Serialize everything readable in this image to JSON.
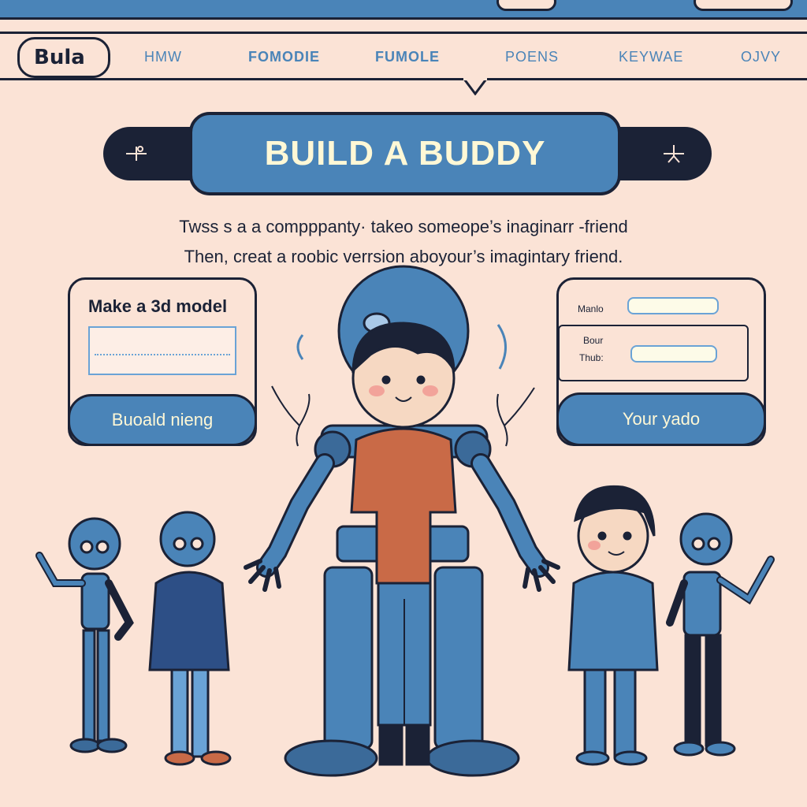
{
  "app": {
    "logo": "Bula"
  },
  "nav": {
    "items": [
      "HMW",
      "FOMODIE",
      "FUMOLE",
      "POENS",
      "KEYWAE",
      "OJVY"
    ]
  },
  "hero": {
    "title": "BUILD A BUDDY",
    "line1": "Twss s a a compppanty· takeo someope’s inaginarr -friend",
    "line2": "Then,  creat a roobic verrsion aboyour’s imagintary friend."
  },
  "left_card": {
    "title": "Make a 3d model",
    "input_value": "",
    "button": "Buoald nieng"
  },
  "right_card": {
    "label1": "Manlo",
    "label2": "Bour",
    "label3": "Thub:",
    "button": "Your yado"
  },
  "colors": {
    "background": "#fbe3d6",
    "accent": "#4a84b8",
    "ink": "#1b2236",
    "shirt": "#c96a47"
  },
  "icons": {
    "banner_left": "tool-icon",
    "banner_right": "tool-icon"
  }
}
